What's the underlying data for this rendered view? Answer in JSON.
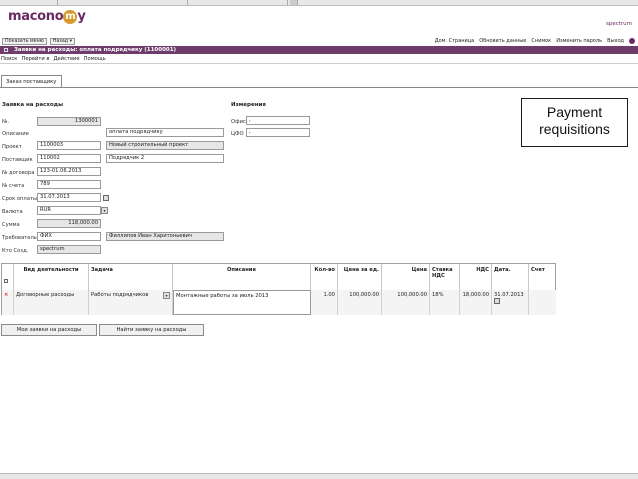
{
  "header": {
    "logo_text": "macono",
    "logo_o": "m",
    "logo_tail": "y",
    "user": "spectrum",
    "show_menu": "Показать меню",
    "back": "Назад ▾"
  },
  "top_links": [
    "Дом. Страница",
    "Обновить данные",
    "Снимок",
    "Изменить пароль",
    "Выход"
  ],
  "window_title": "Заявки на расходы: оплата подрядчику (1100001)",
  "menu": [
    "Поиск",
    "Перейти в",
    "Действие",
    "Помощь"
  ],
  "tab_label": "Заказ поставщику",
  "request": {
    "title": "Заявка на расходы",
    "fields": [
      {
        "label": "№.",
        "value": "1300001"
      },
      {
        "label": "Описание",
        "value": "оплата подрядчику"
      },
      {
        "label": "Проект",
        "value": "1100003",
        "extra": "Новый строительный проект"
      },
      {
        "label": "Поставщик",
        "value": "110002",
        "extra": "Подрядчик 2"
      },
      {
        "label": "№ договора",
        "value": "123-01.06.2013"
      },
      {
        "label": "№ счета",
        "value": "789"
      },
      {
        "label": "Срок оплаты",
        "value": "31.07.2013"
      },
      {
        "label": "Валюта",
        "value": "RUR"
      },
      {
        "label": "Сумма",
        "value": "118,000.00"
      },
      {
        "label": "Требователь",
        "value": "ФИХ",
        "extra": "Филлипов Иван Харитоньевич"
      },
      {
        "label": "Кто Созд.",
        "value": "spectrum"
      }
    ]
  },
  "dimensions": {
    "title": "Измерения",
    "office_label": "Офис",
    "office_value": ",",
    "cfo_label": "ЦФО",
    "cfo_value": ","
  },
  "callout": {
    "line1": "Payment",
    "line2": "requisitions"
  },
  "grid": {
    "headers": [
      "Вид деятельности",
      "Задача",
      "Описание",
      "Кол-во",
      "Цена за ед.",
      "Цена",
      "Ставка НДС",
      "НДС",
      "Дата.",
      "Счет"
    ],
    "row": [
      "Договорные расходы",
      "Работы подрядчиков",
      "Монтажные работы за июль 2013",
      "1.00",
      "100,000.00",
      "100,000.00",
      "18%",
      "18,000.00",
      "31.07.2013",
      ""
    ]
  },
  "buttons": {
    "my_requests": "Мои заявки на расходы",
    "find_request": "Найти заявку на расходы"
  },
  "colors": {
    "brand": "#6e3c6b",
    "logo_accent": "#d49a2c"
  }
}
